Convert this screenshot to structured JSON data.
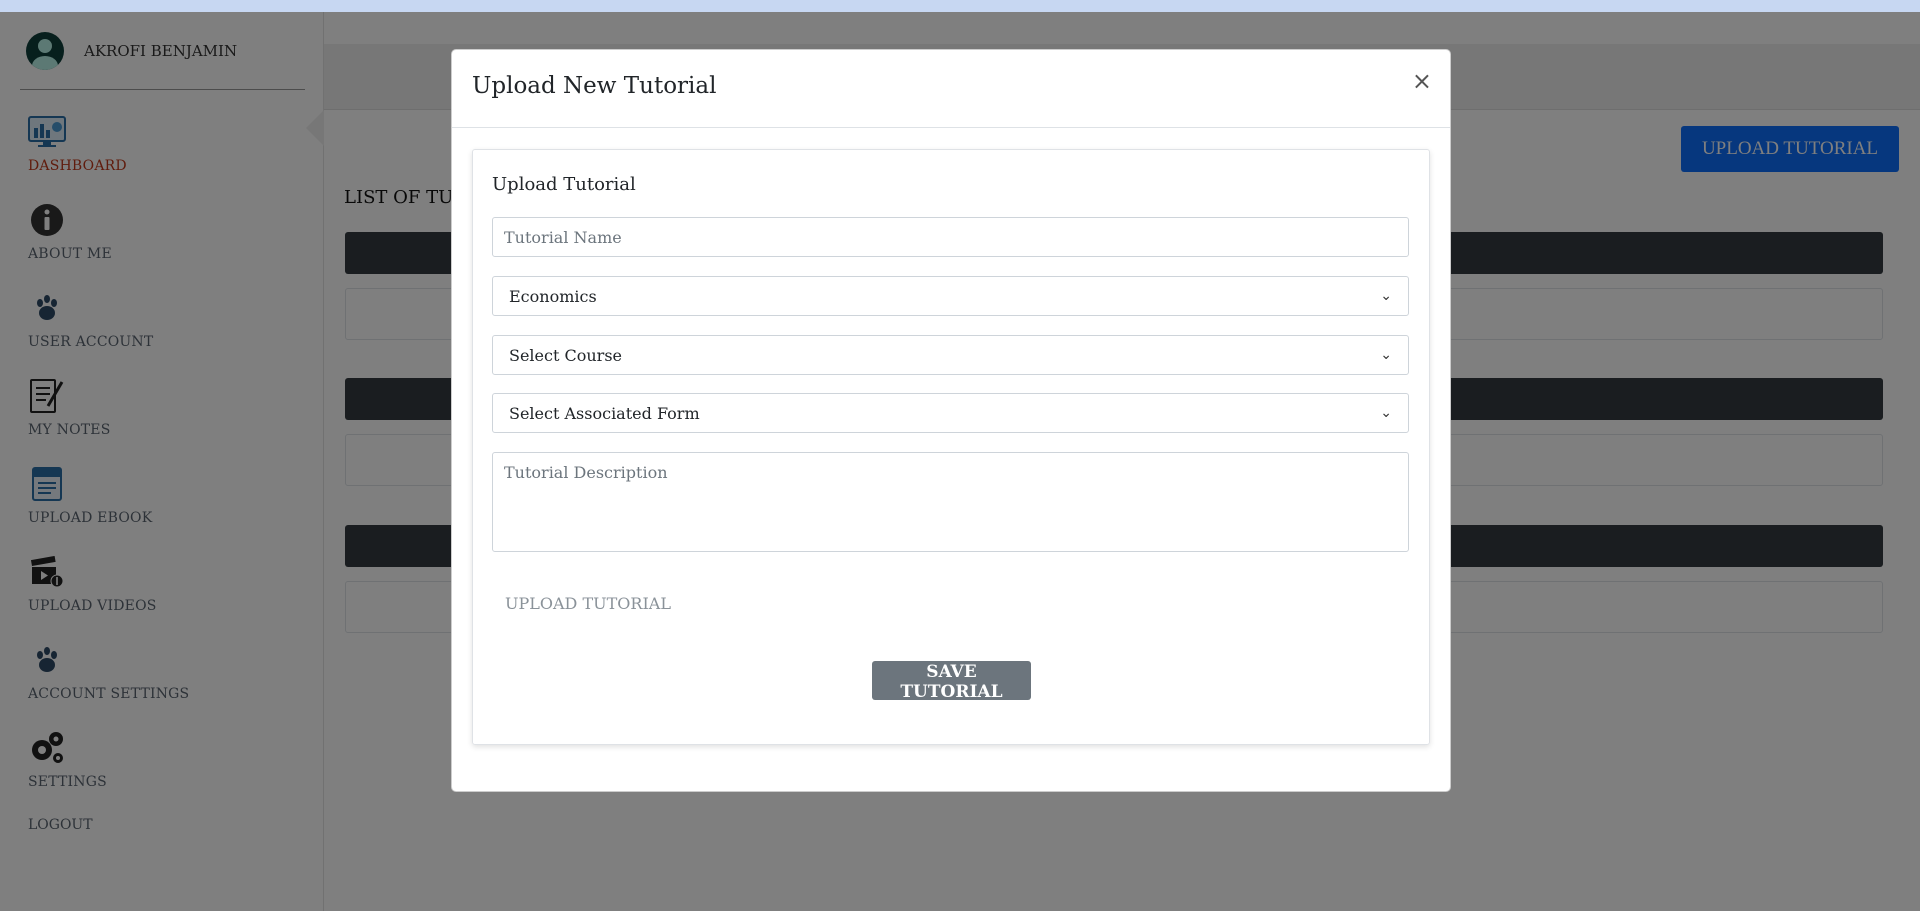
{
  "user": {
    "name": "AKROFI BENJAMIN"
  },
  "sidebar": {
    "items": [
      {
        "label": "DASHBOARD",
        "icon": "dashboard-icon",
        "active": true
      },
      {
        "label": "ABOUT ME",
        "icon": "info-icon"
      },
      {
        "label": "USER ACCOUNT",
        "icon": "paw-icon"
      },
      {
        "label": "MY NOTES",
        "icon": "notes-icon"
      },
      {
        "label": "UPLOAD EBOOK",
        "icon": "ebook-icon"
      },
      {
        "label": "UPLOAD VIDEOS",
        "icon": "video-upload-icon"
      },
      {
        "label": "ACCOUNT SETTINGS",
        "icon": "paw-icon"
      },
      {
        "label": "SETTINGS",
        "icon": "gears-icon"
      }
    ],
    "logout": "LOGOUT"
  },
  "main": {
    "upload_button": "UPLOAD TUTORIAL",
    "list_title": "LIST OF TUTORIALS"
  },
  "modal": {
    "title": "Upload New Tutorial",
    "close": "×",
    "card_title": "Upload Tutorial",
    "name_placeholder": "Tutorial Name",
    "subject_selected": "Economics",
    "course_selected": "Select Course",
    "form_selected": "Select Associated Form",
    "description_placeholder": "Tutorial Description",
    "file_label": "UPLOAD TUTORIAL",
    "save_button": "SAVE TUTORIAL"
  },
  "colors": {
    "accent": "#0d6efd",
    "active_nav": "#c0391b",
    "dark_bar": "#343a40",
    "secondary_button": "#6c757d"
  }
}
